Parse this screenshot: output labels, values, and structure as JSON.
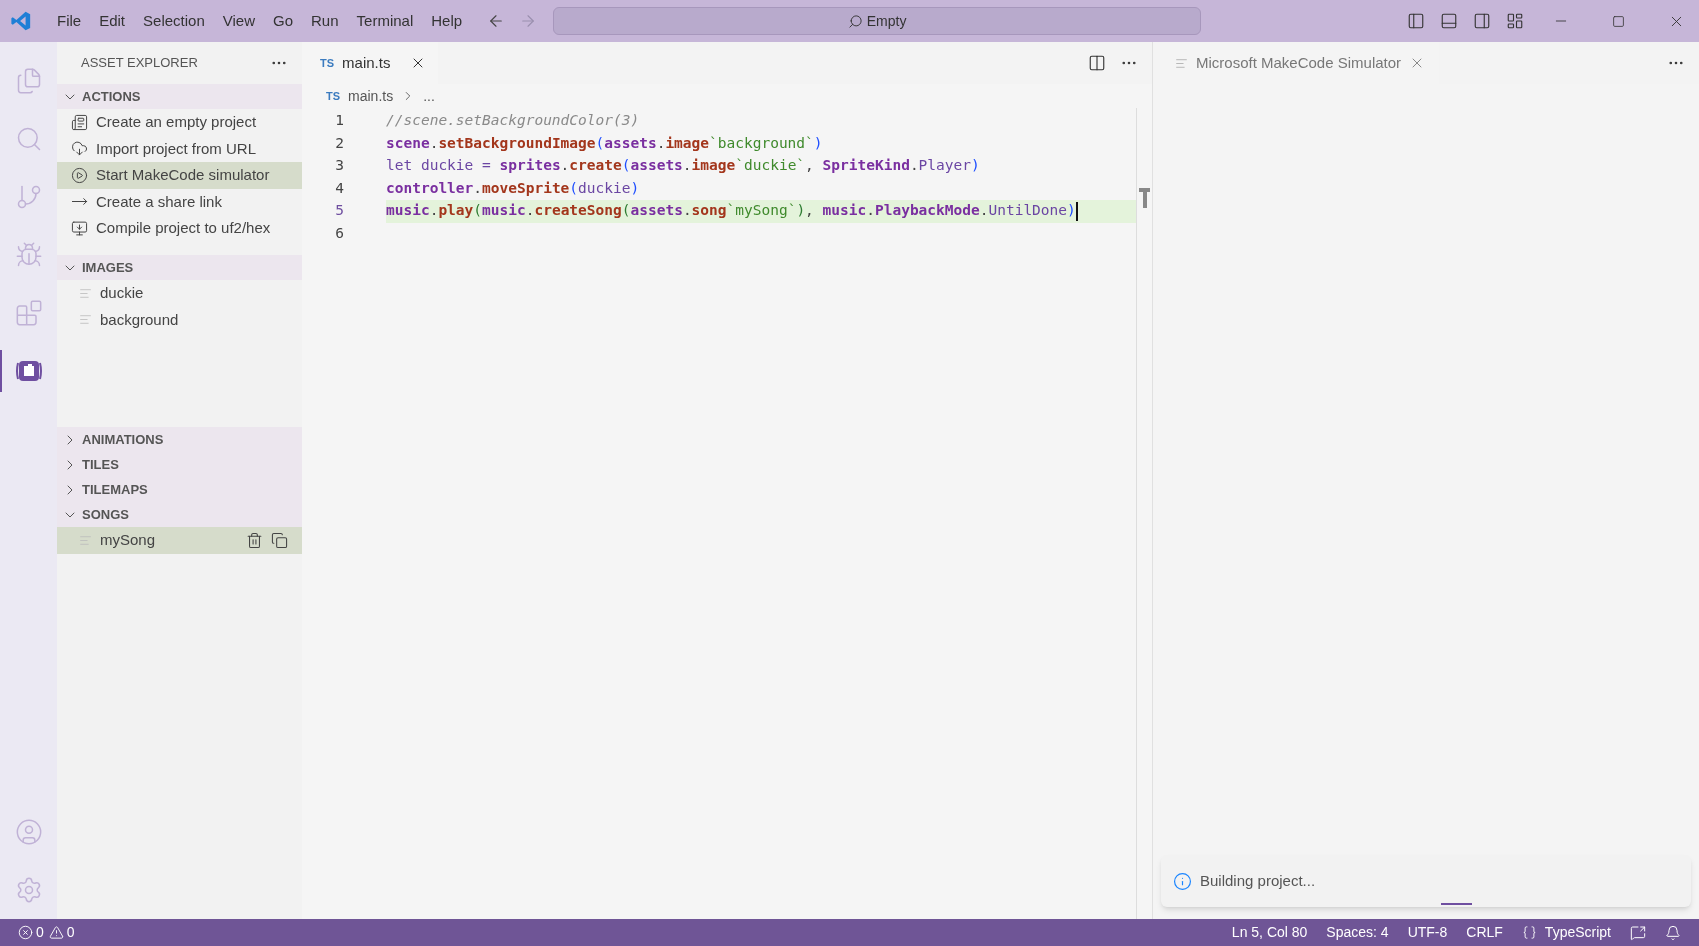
{
  "title_bar": {
    "menu": [
      "File",
      "Edit",
      "Selection",
      "View",
      "Go",
      "Run",
      "Terminal",
      "Help"
    ],
    "command_center": {
      "placeholder": "Empty"
    }
  },
  "activity_bar": {
    "top": [
      {
        "kind": "explorer",
        "selected": false
      },
      {
        "kind": "search",
        "selected": false
      },
      {
        "kind": "source-control",
        "selected": false
      },
      {
        "kind": "run-debug",
        "selected": false
      },
      {
        "kind": "extensions",
        "selected": false
      },
      {
        "kind": "makecode",
        "selected": true
      }
    ],
    "bottom": [
      {
        "kind": "account",
        "selected": false
      },
      {
        "kind": "settings",
        "selected": false
      }
    ]
  },
  "sidebar": {
    "title": "ASSET EXPLORER",
    "sections": [
      {
        "title": "ACTIONS",
        "expanded": true,
        "kind": "actions",
        "items": [
          {
            "label": "Create an empty project",
            "kind": "create",
            "selected": false
          },
          {
            "label": "Import project from URL",
            "kind": "import",
            "selected": false
          },
          {
            "label": "Start MakeCode simulator",
            "kind": "simulate",
            "selected": true
          },
          {
            "label": "Create a share link",
            "kind": "share",
            "selected": false
          },
          {
            "label": "Compile project to uf2/hex",
            "kind": "compile",
            "selected": false
          }
        ]
      },
      {
        "title": "IMAGES",
        "expanded": true,
        "kind": "assets",
        "items": [
          {
            "label": "duckie",
            "selected": false
          },
          {
            "label": "background",
            "selected": false
          }
        ]
      },
      {
        "title": "ANIMATIONS",
        "expanded": false,
        "kind": "assets"
      },
      {
        "title": "TILES",
        "expanded": false,
        "kind": "assets"
      },
      {
        "title": "TILEMAPS",
        "expanded": false,
        "kind": "assets"
      },
      {
        "title": "SONGS",
        "expanded": true,
        "kind": "assets",
        "items": [
          {
            "label": "mySong",
            "selected": true
          }
        ]
      }
    ]
  },
  "editor": {
    "tab": {
      "badge": "TS",
      "label": "main.ts"
    },
    "breadcrumb": {
      "badge": "TS",
      "file": "main.ts",
      "rest": "..."
    },
    "lines": [
      {
        "number": "1",
        "current": false,
        "tokens": [
          {
            "kind": "comment",
            "text": "//scene.setBackgroundColor(3)"
          }
        ]
      },
      {
        "number": "2",
        "current": false,
        "tokens": [
          {
            "kind": "object",
            "text": "scene"
          },
          {
            "kind": "punct",
            "text": "."
          },
          {
            "kind": "member",
            "text": "setBackgroundImage"
          },
          {
            "kind": "bracket1",
            "text": "("
          },
          {
            "kind": "object",
            "text": "assets"
          },
          {
            "kind": "punct",
            "text": "."
          },
          {
            "kind": "member",
            "text": "image"
          },
          {
            "kind": "string",
            "text": "`background`"
          },
          {
            "kind": "bracket1",
            "text": ")"
          }
        ]
      },
      {
        "number": "3",
        "current": false,
        "tokens": [
          {
            "kind": "text",
            "text": "let duckie = "
          },
          {
            "kind": "object",
            "text": "sprites"
          },
          {
            "kind": "punct",
            "text": "."
          },
          {
            "kind": "member",
            "text": "create"
          },
          {
            "kind": "bracket1",
            "text": "("
          },
          {
            "kind": "object",
            "text": "assets"
          },
          {
            "kind": "punct",
            "text": "."
          },
          {
            "kind": "member",
            "text": "image"
          },
          {
            "kind": "string",
            "text": "`duckie`"
          },
          {
            "kind": "punct",
            "text": ", "
          },
          {
            "kind": "object",
            "text": "SpriteKind"
          },
          {
            "kind": "punct",
            "text": "."
          },
          {
            "kind": "text",
            "text": "Player"
          },
          {
            "kind": "bracket1",
            "text": ")"
          }
        ]
      },
      {
        "number": "4",
        "current": false,
        "tokens": [
          {
            "kind": "object",
            "text": "controller"
          },
          {
            "kind": "punct",
            "text": "."
          },
          {
            "kind": "member",
            "text": "moveSprite"
          },
          {
            "kind": "bracket1",
            "text": "("
          },
          {
            "kind": "text",
            "text": "duckie"
          },
          {
            "kind": "bracket1",
            "text": ")"
          }
        ]
      },
      {
        "number": "5",
        "current": true,
        "tokens": [
          {
            "kind": "object",
            "text": "music"
          },
          {
            "kind": "punct",
            "text": "."
          },
          {
            "kind": "member",
            "text": "play"
          },
          {
            "kind": "bracket2",
            "text": "("
          },
          {
            "kind": "object",
            "text": "music"
          },
          {
            "kind": "punct",
            "text": "."
          },
          {
            "kind": "member",
            "text": "createSong"
          },
          {
            "kind": "bracket2",
            "text": "("
          },
          {
            "kind": "object",
            "text": "assets"
          },
          {
            "kind": "punct",
            "text": "."
          },
          {
            "kind": "member",
            "text": "song"
          },
          {
            "kind": "string",
            "text": "`mySong`"
          },
          {
            "kind": "bracket2",
            "text": ")"
          },
          {
            "kind": "punct",
            "text": ", "
          },
          {
            "kind": "object",
            "text": "music"
          },
          {
            "kind": "punct",
            "text": "."
          },
          {
            "kind": "object",
            "text": "PlaybackMode"
          },
          {
            "kind": "punct",
            "text": "."
          },
          {
            "kind": "text",
            "text": "UntilDone"
          },
          {
            "kind": "bracket1",
            "text": ")"
          }
        ]
      },
      {
        "number": "6",
        "current": false
      }
    ]
  },
  "simulator": {
    "tab": {
      "label": "Microsoft MakeCode Simulator"
    }
  },
  "notification": {
    "message": "Building project..."
  },
  "status_bar": {
    "errors": "0",
    "warnings": "0",
    "items": [
      "Ln 5, Col 80",
      "Spaces: 4",
      "UTF-8",
      "CRLF"
    ],
    "language": "TypeScript"
  }
}
